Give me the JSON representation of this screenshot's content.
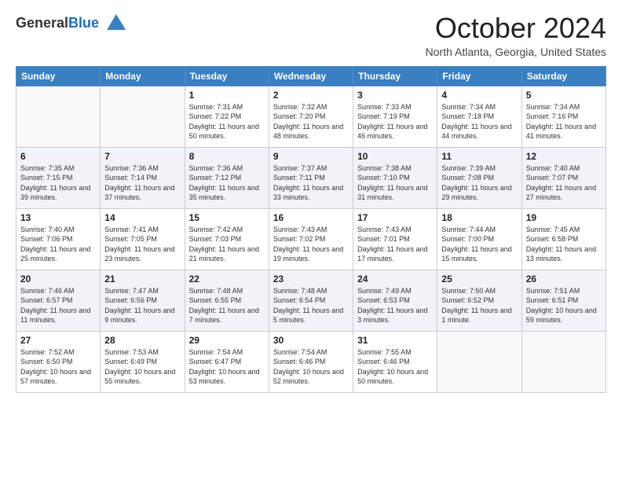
{
  "logo": {
    "general": "General",
    "blue": "Blue"
  },
  "header": {
    "month": "October 2024",
    "location": "North Atlanta, Georgia, United States"
  },
  "days_of_week": [
    "Sunday",
    "Monday",
    "Tuesday",
    "Wednesday",
    "Thursday",
    "Friday",
    "Saturday"
  ],
  "weeks": [
    [
      {
        "day": "",
        "sunrise": "",
        "sunset": "",
        "daylight": ""
      },
      {
        "day": "",
        "sunrise": "",
        "sunset": "",
        "daylight": ""
      },
      {
        "day": "1",
        "sunrise": "Sunrise: 7:31 AM",
        "sunset": "Sunset: 7:22 PM",
        "daylight": "Daylight: 11 hours and 50 minutes."
      },
      {
        "day": "2",
        "sunrise": "Sunrise: 7:32 AM",
        "sunset": "Sunset: 7:20 PM",
        "daylight": "Daylight: 11 hours and 48 minutes."
      },
      {
        "day": "3",
        "sunrise": "Sunrise: 7:33 AM",
        "sunset": "Sunset: 7:19 PM",
        "daylight": "Daylight: 11 hours and 46 minutes."
      },
      {
        "day": "4",
        "sunrise": "Sunrise: 7:34 AM",
        "sunset": "Sunset: 7:18 PM",
        "daylight": "Daylight: 11 hours and 44 minutes."
      },
      {
        "day": "5",
        "sunrise": "Sunrise: 7:34 AM",
        "sunset": "Sunset: 7:16 PM",
        "daylight": "Daylight: 11 hours and 41 minutes."
      }
    ],
    [
      {
        "day": "6",
        "sunrise": "Sunrise: 7:35 AM",
        "sunset": "Sunset: 7:15 PM",
        "daylight": "Daylight: 11 hours and 39 minutes."
      },
      {
        "day": "7",
        "sunrise": "Sunrise: 7:36 AM",
        "sunset": "Sunset: 7:14 PM",
        "daylight": "Daylight: 11 hours and 37 minutes."
      },
      {
        "day": "8",
        "sunrise": "Sunrise: 7:36 AM",
        "sunset": "Sunset: 7:12 PM",
        "daylight": "Daylight: 11 hours and 35 minutes."
      },
      {
        "day": "9",
        "sunrise": "Sunrise: 7:37 AM",
        "sunset": "Sunset: 7:11 PM",
        "daylight": "Daylight: 11 hours and 33 minutes."
      },
      {
        "day": "10",
        "sunrise": "Sunrise: 7:38 AM",
        "sunset": "Sunset: 7:10 PM",
        "daylight": "Daylight: 11 hours and 31 minutes."
      },
      {
        "day": "11",
        "sunrise": "Sunrise: 7:39 AM",
        "sunset": "Sunset: 7:08 PM",
        "daylight": "Daylight: 11 hours and 29 minutes."
      },
      {
        "day": "12",
        "sunrise": "Sunrise: 7:40 AM",
        "sunset": "Sunset: 7:07 PM",
        "daylight": "Daylight: 11 hours and 27 minutes."
      }
    ],
    [
      {
        "day": "13",
        "sunrise": "Sunrise: 7:40 AM",
        "sunset": "Sunset: 7:06 PM",
        "daylight": "Daylight: 11 hours and 25 minutes."
      },
      {
        "day": "14",
        "sunrise": "Sunrise: 7:41 AM",
        "sunset": "Sunset: 7:05 PM",
        "daylight": "Daylight: 11 hours and 23 minutes."
      },
      {
        "day": "15",
        "sunrise": "Sunrise: 7:42 AM",
        "sunset": "Sunset: 7:03 PM",
        "daylight": "Daylight: 11 hours and 21 minutes."
      },
      {
        "day": "16",
        "sunrise": "Sunrise: 7:43 AM",
        "sunset": "Sunset: 7:02 PM",
        "daylight": "Daylight: 11 hours and 19 minutes."
      },
      {
        "day": "17",
        "sunrise": "Sunrise: 7:43 AM",
        "sunset": "Sunset: 7:01 PM",
        "daylight": "Daylight: 11 hours and 17 minutes."
      },
      {
        "day": "18",
        "sunrise": "Sunrise: 7:44 AM",
        "sunset": "Sunset: 7:00 PM",
        "daylight": "Daylight: 11 hours and 15 minutes."
      },
      {
        "day": "19",
        "sunrise": "Sunrise: 7:45 AM",
        "sunset": "Sunset: 6:58 PM",
        "daylight": "Daylight: 11 hours and 13 minutes."
      }
    ],
    [
      {
        "day": "20",
        "sunrise": "Sunrise: 7:46 AM",
        "sunset": "Sunset: 6:57 PM",
        "daylight": "Daylight: 11 hours and 11 minutes."
      },
      {
        "day": "21",
        "sunrise": "Sunrise: 7:47 AM",
        "sunset": "Sunset: 6:56 PM",
        "daylight": "Daylight: 11 hours and 9 minutes."
      },
      {
        "day": "22",
        "sunrise": "Sunrise: 7:48 AM",
        "sunset": "Sunset: 6:55 PM",
        "daylight": "Daylight: 11 hours and 7 minutes."
      },
      {
        "day": "23",
        "sunrise": "Sunrise: 7:48 AM",
        "sunset": "Sunset: 6:54 PM",
        "daylight": "Daylight: 11 hours and 5 minutes."
      },
      {
        "day": "24",
        "sunrise": "Sunrise: 7:49 AM",
        "sunset": "Sunset: 6:53 PM",
        "daylight": "Daylight: 11 hours and 3 minutes."
      },
      {
        "day": "25",
        "sunrise": "Sunrise: 7:50 AM",
        "sunset": "Sunset: 6:52 PM",
        "daylight": "Daylight: 11 hours and 1 minute."
      },
      {
        "day": "26",
        "sunrise": "Sunrise: 7:51 AM",
        "sunset": "Sunset: 6:51 PM",
        "daylight": "Daylight: 10 hours and 59 minutes."
      }
    ],
    [
      {
        "day": "27",
        "sunrise": "Sunrise: 7:52 AM",
        "sunset": "Sunset: 6:50 PM",
        "daylight": "Daylight: 10 hours and 57 minutes."
      },
      {
        "day": "28",
        "sunrise": "Sunrise: 7:53 AM",
        "sunset": "Sunset: 6:49 PM",
        "daylight": "Daylight: 10 hours and 55 minutes."
      },
      {
        "day": "29",
        "sunrise": "Sunrise: 7:54 AM",
        "sunset": "Sunset: 6:47 PM",
        "daylight": "Daylight: 10 hours and 53 minutes."
      },
      {
        "day": "30",
        "sunrise": "Sunrise: 7:54 AM",
        "sunset": "Sunset: 6:46 PM",
        "daylight": "Daylight: 10 hours and 52 minutes."
      },
      {
        "day": "31",
        "sunrise": "Sunrise: 7:55 AM",
        "sunset": "Sunset: 6:46 PM",
        "daylight": "Daylight: 10 hours and 50 minutes."
      },
      {
        "day": "",
        "sunrise": "",
        "sunset": "",
        "daylight": ""
      },
      {
        "day": "",
        "sunrise": "",
        "sunset": "",
        "daylight": ""
      }
    ]
  ]
}
